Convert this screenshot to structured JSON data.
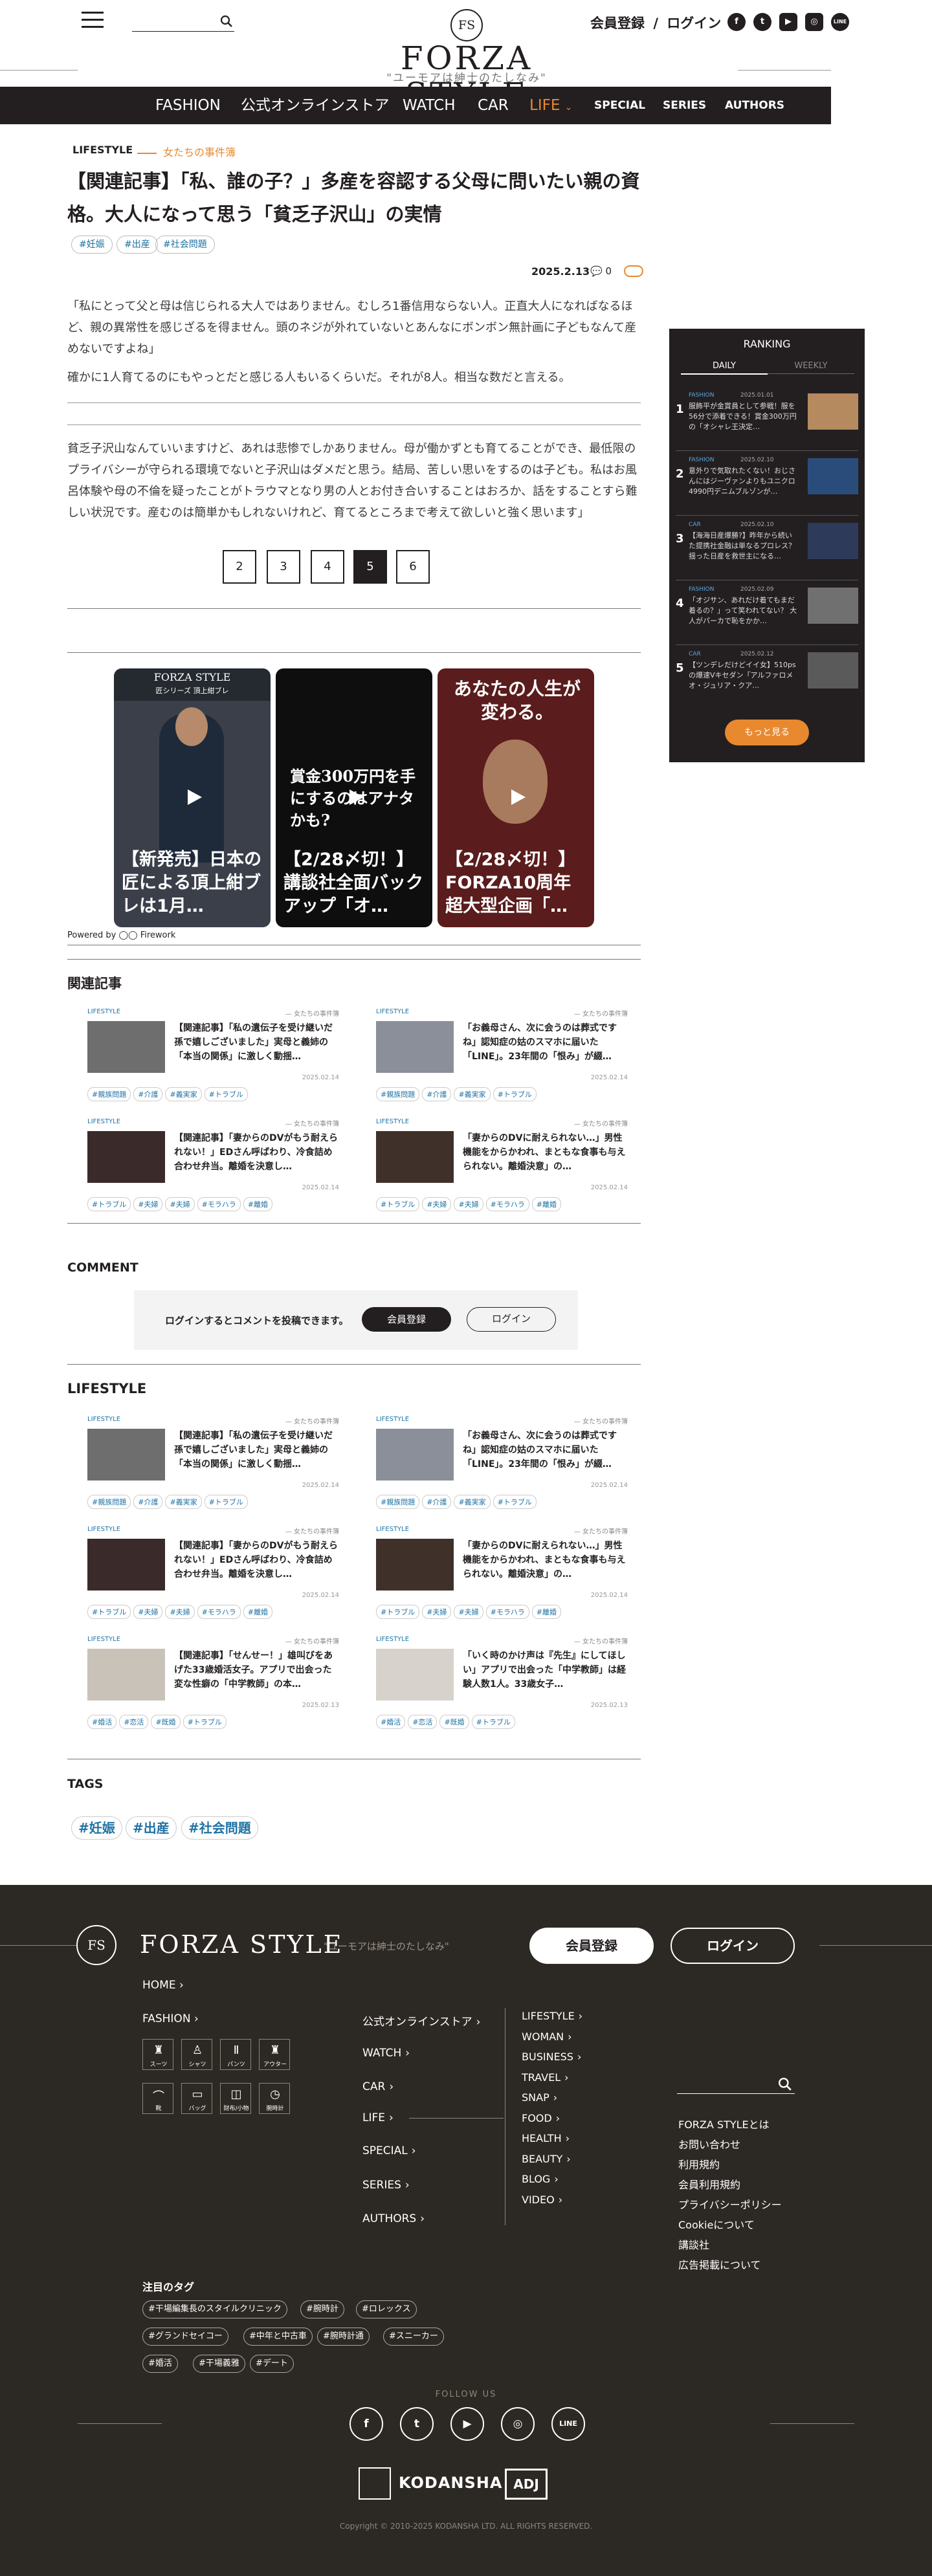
{
  "header": {
    "logo_mark": "FS",
    "logo_word": "FORZA STYLE",
    "tagline": "\"ユーモアは紳士のたしなみ\"",
    "member_link": "会員登録",
    "login_link": "ログイン",
    "separator": "/",
    "social": [
      "f",
      "t",
      "▶",
      "◎",
      "LINE"
    ]
  },
  "nav": [
    "FASHION",
    "公式オンラインストア",
    "WATCH",
    "CAR",
    "LIFE",
    "SPECIAL",
    "SERIES",
    "AUTHORS"
  ],
  "article": {
    "category": "LIFESTYLE",
    "subcategory": "女たちの事件簿",
    "title": "【関連記事】「私、誰の子？」多産を容認する父母に問いたい親の資格。大人になって思う「貧乏子沢山」の実情",
    "tags": [
      "#妊娠",
      "#出産",
      "#社会問題"
    ],
    "date": "2025.2.13",
    "comment_count": "0",
    "para1": "「私にとって父と母は信じられる大人ではありません。むしろ1番信用ならない人。正直大人になればなるほど、親の異常性を感じざるを得ません。頭のネジが外れていないとあんなにボンボン無計画に子どもなんて産めないですよね」",
    "para2": "確かに1人育てるのにもやっとだと感じる人もいるくらいだ。それが8人。相当な数だと言える。",
    "para3": "貧乏子沢山なんていいますけど、あれは悲惨でしかありません。母が働かずとも育てることができ、最低限のプライバシーが守られる環境でないと子沢山はダメだと思う。結局、苦しい思いをするのは子ども。私はお風呂体験や母の不倫を疑ったことがトラウマとなり男の人とお付き合いすることはおろか、話をすることすら難しい状況です。産むのは簡単かもしれないけれど、育てるところまで考えて欲しいと強く思います」",
    "pages": [
      "2",
      "3",
      "4",
      "5",
      "6"
    ],
    "current_page": "5"
  },
  "videos": {
    "items": [
      "【新発売】日本の匠による頂上紺ブレは1月…",
      "【2/28〆切！】講談社全面バックアップ「オ…",
      "【2/28〆切！】FORZA10周年超大型企画「…"
    ],
    "overlay1": "FORZA STYLE",
    "overlay1b": "匠シリーズ 頂上紺ブレ",
    "overlay2": "賞金300万円を手にするのはアナタかも?",
    "overlay3": "あなたの人生が変わる。",
    "powered": "Powered by ◯◯ Firework"
  },
  "related": {
    "heading": "関連記事",
    "cards": [
      {
        "tag": "LIFESTYLE",
        "sub": "— 女たちの事件簿",
        "title": "【関連記事】「私の遺伝子を受け継いだ孫で嬉しございました」実母と義姉の「本当の関係」に激しく動揺…",
        "date": "2025.02.14",
        "pills": [
          "#親族問題",
          "#介護",
          "#義実家",
          "#トラブル"
        ]
      },
      {
        "tag": "LIFESTYLE",
        "sub": "— 女たちの事件簿",
        "title": "「お義母さん、次に会うのは葬式ですね」認知症の姑のスマホに届いた「LINE」。23年間の「恨み」が綴…",
        "date": "2025.02.14",
        "pills": [
          "#親族問題",
          "#介護",
          "#義実家",
          "#トラブル"
        ]
      },
      {
        "tag": "LIFESTYLE",
        "sub": "— 女たちの事件簿",
        "title": "【関連記事】「妻からのDVがもう耐えられない！」EDさん呼ばわり、冷食詰め合わせ弁当。離婚を決意し…",
        "date": "2025.02.14",
        "pills": [
          "#トラブル",
          "#夫婦",
          "#夫婦",
          "#モラハラ",
          "#離婚"
        ]
      },
      {
        "tag": "LIFESTYLE",
        "sub": "— 女たちの事件簿",
        "title": "「妻からのDVに耐えられない…」男性機能をからかわれ、まともな食事も与えられない。離婚決意」の…",
        "date": "2025.02.14",
        "pills": [
          "#トラブル",
          "#夫婦",
          "#夫婦",
          "#モラハラ",
          "#離婚"
        ]
      }
    ]
  },
  "comment": {
    "heading": "COMMENT",
    "text": "ログインするとコメントを投稿できます。",
    "register": "会員登録",
    "login": "ログイン"
  },
  "lifestyle": {
    "heading": "LIFESTYLE",
    "cards": [
      {
        "tag": "LIFESTYLE",
        "sub": "— 女たちの事件簿",
        "title": "【関連記事】「私の遺伝子を受け継いだ孫で嬉しございました」実母と義姉の「本当の関係」に激しく動揺…",
        "date": "2025.02.14",
        "pills": [
          "#親族問題",
          "#介護",
          "#義実家",
          "#トラブル"
        ]
      },
      {
        "tag": "LIFESTYLE",
        "sub": "— 女たちの事件簿",
        "title": "「お義母さん、次に会うのは葬式ですね」認知症の姑のスマホに届いた「LINE」。23年間の「恨み」が綴…",
        "date": "2025.02.14",
        "pills": [
          "#親族問題",
          "#介護",
          "#義実家",
          "#トラブル"
        ]
      },
      {
        "tag": "LIFESTYLE",
        "sub": "— 女たちの事件簿",
        "title": "【関連記事】「妻からのDVがもう耐えられない！」EDさん呼ばわり、冷食詰め合わせ弁当。離婚を決意し…",
        "date": "2025.02.14",
        "pills": [
          "#トラブル",
          "#夫婦",
          "#夫婦",
          "#モラハラ",
          "#離婚"
        ]
      },
      {
        "tag": "LIFESTYLE",
        "sub": "— 女たちの事件簿",
        "title": "「妻からのDVに耐えられない…」男性機能をからかわれ、まともな食事も与えられない。離婚決意」の…",
        "date": "2025.02.14",
        "pills": [
          "#トラブル",
          "#夫婦",
          "#夫婦",
          "#モラハラ",
          "#離婚"
        ]
      },
      {
        "tag": "LIFESTYLE",
        "sub": "— 女たちの事件簿",
        "title": "【関連記事】「せんせー！」雄叫びをあげた33歳婚活女子。アプリで出会った変な性癖の「中学教師」の本…",
        "date": "2025.02.13",
        "pills": [
          "#婚活",
          "#恋活",
          "#既婚",
          "#トラブル"
        ]
      },
      {
        "tag": "LIFESTYLE",
        "sub": "— 女たちの事件簿",
        "title": "「いく時のかけ声は『先生』にしてほしい」アプリで出会った「中学教師」は経験人数1人。33歳女子…",
        "date": "2025.02.13",
        "pills": [
          "#婚活",
          "#恋活",
          "#既婚",
          "#トラブル"
        ]
      }
    ]
  },
  "tags": {
    "heading": "TAGS",
    "items": [
      "#妊娠",
      "#出産",
      "#社会問題"
    ]
  },
  "ranking": {
    "title": "RANKING",
    "tab_daily": "DAILY",
    "tab_weekly": "WEEKLY",
    "more": "もっと見る",
    "items": [
      {
        "n": "1",
        "cat": "FASHION",
        "date": "2025.01.01",
        "title": "服飾平が金賞員として参戦！服を56分で添着できる！賞金300万円の「オシャレ王決定…"
      },
      {
        "n": "2",
        "cat": "FASHION",
        "date": "2025.02.10",
        "title": "意外りで気取れたくない！おじさんにはジーヴァンよりもユニクロ4990円デニムブルゾンが…"
      },
      {
        "n": "3",
        "cat": "CAR",
        "date": "2025.02.10",
        "title": "【海海日産爆勝?】昨年から続いた提携社金融は単なるプロレス？ 揺った日産を救世主になる…"
      },
      {
        "n": "4",
        "cat": "FASHION",
        "date": "2025.02.09",
        "title": "「オジサン、あれだけ着てもまだ着るの？」って笑われてない？ 大人がパーカで恥をかか…"
      },
      {
        "n": "5",
        "cat": "CAR",
        "date": "2025.02.12",
        "title": "【ツンデレだけどイイ女】510psの爆速Vキセダン「アルファロメオ・ジュリア・クア…"
      }
    ]
  },
  "footer": {
    "logo_mark": "FS",
    "logo_word": "FORZA STYLE",
    "tagline": "\"ユーモアは紳士のたしなみ\"",
    "register": "会員登録",
    "login": "ログイン",
    "home": "HOME",
    "fashion": "FASHION",
    "fashion_icons": [
      "スーツ",
      "シャツ",
      "パンツ",
      "アウター",
      "靴",
      "バッグ",
      "財布/小物",
      "腕時計"
    ],
    "col2": [
      "公式オンラインストア",
      "WATCH",
      "CAR",
      "LIFE",
      "SPECIAL",
      "SERIES",
      "AUTHORS"
    ],
    "col3": [
      "LIFESTYLE",
      "WOMAN",
      "BUSINESS",
      "TRAVEL",
      "SNAP",
      "FOOD",
      "HEALTH",
      "BEAUTY",
      "BLOG",
      "VIDEO"
    ],
    "links": [
      "FORZA STYLEとは",
      "お問い合わせ",
      "利用規約",
      "会員利用規約",
      "プライバシーポリシー",
      "Cookieについて",
      "講談社",
      "広告掲載について"
    ],
    "tags_heading": "注目のタグ",
    "tags": [
      "#干場編集長のスタイルクリニック",
      "#腕時計",
      "#ロレックス",
      "#グランドセイコー",
      "#中年と中古車",
      "#腕時計通",
      "#スニーカー",
      "#婚活",
      "#干場義雅",
      "#デート"
    ],
    "follow": "FOLLOW US",
    "social": [
      "f",
      "t",
      "▶",
      "◎",
      "LINE"
    ],
    "kodansha": "KODANSHA",
    "adj": "ADJ",
    "copyright": "Copyright © 2010-2025 KODANSHA LTD. ALL RIGHTS RESERVED."
  }
}
